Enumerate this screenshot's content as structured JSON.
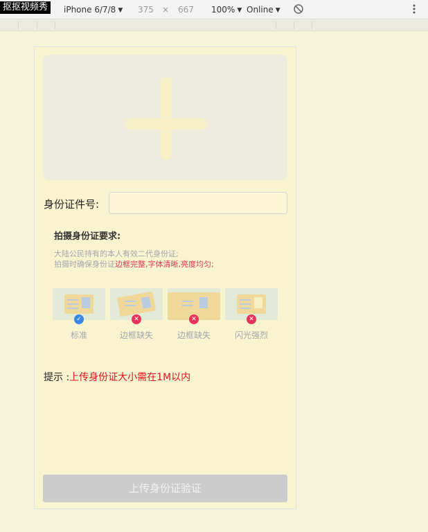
{
  "toolbar": {
    "brand": "抠抠视频秀",
    "device": "iPhone 6/7/8",
    "width": "375",
    "times": "×",
    "height": "667",
    "zoom": "100%",
    "network": "Online"
  },
  "form": {
    "id_label": "身份证件号:",
    "id_value": "",
    "requirements_title": "拍摄身份证要求:",
    "req_line1": "大陆公民持有的本人有效二代身份证;",
    "req_line2_prefix": "拍摄时确保身份证",
    "req_line2_hl1": "边框完整",
    "req_line2_sep1": ",",
    "req_line2_hl2": "字体清晰",
    "req_line2_sep2": ",",
    "req_line2_hl3": "亮度均匀",
    "req_line2_end": ";",
    "samples": [
      {
        "label": "标准",
        "status": "ok"
      },
      {
        "label": "边框缺失",
        "status": "bad"
      },
      {
        "label": "边框缺失",
        "status": "bad"
      },
      {
        "label": "闪光强烈",
        "status": "bad"
      }
    ],
    "tip_prefix": "提示 :",
    "tip_text": "上传身份证大小需在1M以内",
    "submit_label": "上传身份证验证"
  },
  "colors": {
    "page_bg": "#f5f4d9",
    "card_bg": "#f9f4d0",
    "highlight": "#e6345a",
    "tip_red": "#e60f1e",
    "ok_badge": "#3a86e6",
    "submit_bg": "#cccccc"
  },
  "icons": {
    "upload": "plus-icon",
    "ok": "check-icon",
    "bad": "close-icon",
    "rotate": "rotate-disabled-icon",
    "more": "more-vertical-icon"
  }
}
